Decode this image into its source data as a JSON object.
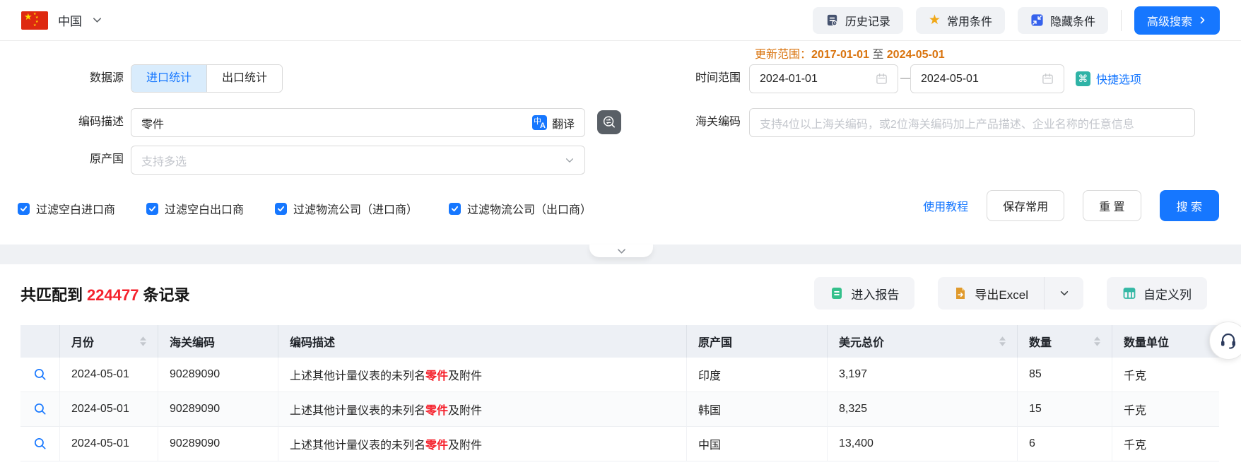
{
  "topbar": {
    "country": "中国",
    "history_label": "历史记录",
    "favorites_label": "常用条件",
    "hide_label": "隐藏条件",
    "advanced_search_label": "高级搜索"
  },
  "form": {
    "update_range": {
      "label": "更新范围：",
      "start": "2017-01-01",
      "to": "至",
      "end": "2024-05-01"
    },
    "data_source": {
      "label": "数据源",
      "tab_import": "进口统计",
      "tab_export": "出口统计",
      "active": "进口统计"
    },
    "code_desc": {
      "label": "编码描述",
      "value": "零件",
      "translate_label": "翻译"
    },
    "origin_country": {
      "label": "原产国",
      "placeholder": "支持多选"
    },
    "time_range": {
      "label": "时间范围",
      "start": "2024-01-01",
      "dash": "—",
      "end": "2024-05-01",
      "quick_label": "快捷选项",
      "quick_icon_glyph": "⌘"
    },
    "hs_code": {
      "label": "海关编码",
      "placeholder": "支持4位以上海关编码，或2位海关编码加上产品描述、企业名称的任意信息"
    },
    "checkboxes": [
      {
        "label": "过滤空白进口商",
        "checked": true
      },
      {
        "label": "过滤空白出口商",
        "checked": true
      },
      {
        "label": "过滤物流公司（进口商）",
        "checked": true
      },
      {
        "label": "过滤物流公司（出口商）",
        "checked": true
      }
    ],
    "tutorial_label": "使用教程",
    "save_label": "保存常用",
    "reset_label": "重 置",
    "search_label": "搜 索"
  },
  "results": {
    "summary_prefix": "共匹配到",
    "count": "224477",
    "summary_suffix": "条记录",
    "report_label": "进入报告",
    "export_label": "导出Excel",
    "custom_columns_label": "自定义列"
  },
  "table": {
    "columns": [
      {
        "label": ""
      },
      {
        "label": "月份",
        "sortable": true
      },
      {
        "label": "海关编码"
      },
      {
        "label": "编码描述"
      },
      {
        "label": "原产国"
      },
      {
        "label": "美元总价",
        "sortable": true
      },
      {
        "label": "数量",
        "sortable": true
      },
      {
        "label": "数量单位"
      }
    ],
    "rows": [
      {
        "month": "2024-05-01",
        "hs_code": "90289090",
        "desc_pre": "上述其他计量仪表的未列名",
        "desc_highlight": "零件",
        "desc_post": "及附件",
        "country": "印度",
        "usd": "3,197",
        "qty": "85",
        "unit": "千克"
      },
      {
        "month": "2024-05-01",
        "hs_code": "90289090",
        "desc_pre": "上述其他计量仪表的未列名",
        "desc_highlight": "零件",
        "desc_post": "及附件",
        "country": "韩国",
        "usd": "8,325",
        "qty": "15",
        "unit": "千克"
      },
      {
        "month": "2024-05-01",
        "hs_code": "90289090",
        "desc_pre": "上述其他计量仪表的未列名",
        "desc_highlight": "零件",
        "desc_post": "及附件",
        "country": "中国",
        "usd": "13,400",
        "qty": "6",
        "unit": "千克"
      }
    ]
  },
  "colors": {
    "primary_blue": "#1677ff",
    "accent_orange": "#d9730d",
    "highlight_red": "#f5222d",
    "teal": "#2fb3a6",
    "report_green": "#34c08b",
    "excel_orange": "#e09a2d",
    "star_gold": "#f0a818",
    "table_header_bg": "#edf0f5"
  }
}
